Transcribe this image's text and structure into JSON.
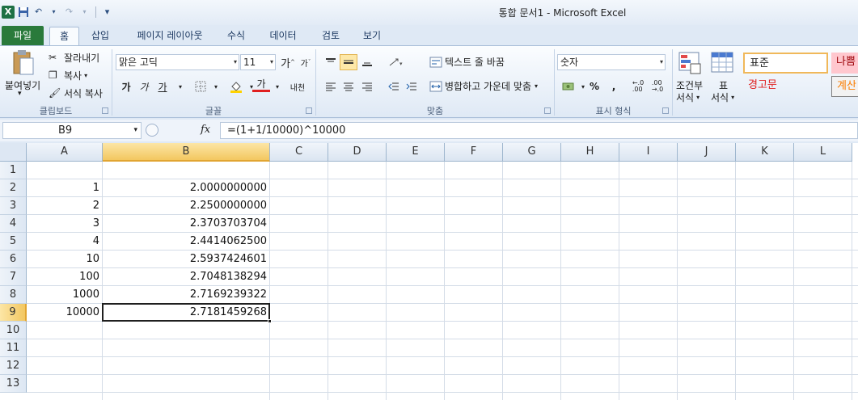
{
  "window": {
    "title": "통합 문서1 - Microsoft Excel"
  },
  "qat": {
    "app_icon": "excel-icon",
    "save": "save-icon",
    "undo": "undo-icon",
    "redo": "redo-icon",
    "customize": "▾"
  },
  "tabs": [
    "파일",
    "홈",
    "삽입",
    "페이지 레이아웃",
    "수식",
    "데이터",
    "검토",
    "보기"
  ],
  "clipboard": {
    "paste": "붙여넣기",
    "cut": "잘라내기",
    "copy": "복사",
    "format_painter": "서식 복사",
    "group": "클립보드"
  },
  "font": {
    "name": "맑은 고딕",
    "size": "11",
    "bold": "가",
    "italic": "가",
    "underline": "가",
    "color_letter": "가",
    "phonetic": "내천",
    "group": "글꼴"
  },
  "alignment": {
    "wrap_text": "텍스트 줄 바꿈",
    "merge_center": "병합하고 가운데 맞춤",
    "group": "맞춤"
  },
  "number": {
    "format": "숫자",
    "percent": "%",
    "comma": ",",
    "group": "표시 형식"
  },
  "styles": {
    "conditional": "조건부\n서식",
    "conditional_1": "조건부",
    "conditional_2": "서식",
    "table_1": "표",
    "table_2": "서식",
    "normal": "표준",
    "bad": "나쁨",
    "warning": "경고문",
    "calc": "계산"
  },
  "formula_bar": {
    "name_box": "B9",
    "fx": "fx",
    "formula": "=(1+1/10000)^10000"
  },
  "columns": [
    "A",
    "B",
    "C",
    "D",
    "E",
    "F",
    "G",
    "H",
    "I",
    "J",
    "K",
    "L"
  ],
  "rows": [
    "1",
    "2",
    "3",
    "4",
    "5",
    "6",
    "7",
    "8",
    "9",
    "10",
    "11",
    "12",
    "13"
  ],
  "cells": {
    "A": [
      "",
      "1",
      "2",
      "3",
      "4",
      "10",
      "100",
      "1000",
      "10000",
      "",
      "",
      "",
      ""
    ],
    "B": [
      "",
      "2.0000000000",
      "2.2500000000",
      "2.3703703704",
      "2.4414062500",
      "2.5937424601",
      "2.7048138294",
      "2.7169239322",
      "2.7181459268",
      "",
      "",
      "",
      ""
    ]
  },
  "selection": {
    "cell": "B9"
  },
  "colors": {
    "file_tab": "#2a7a3b",
    "selected_header": "#f3c760",
    "grid_line": "#d4dce7"
  }
}
